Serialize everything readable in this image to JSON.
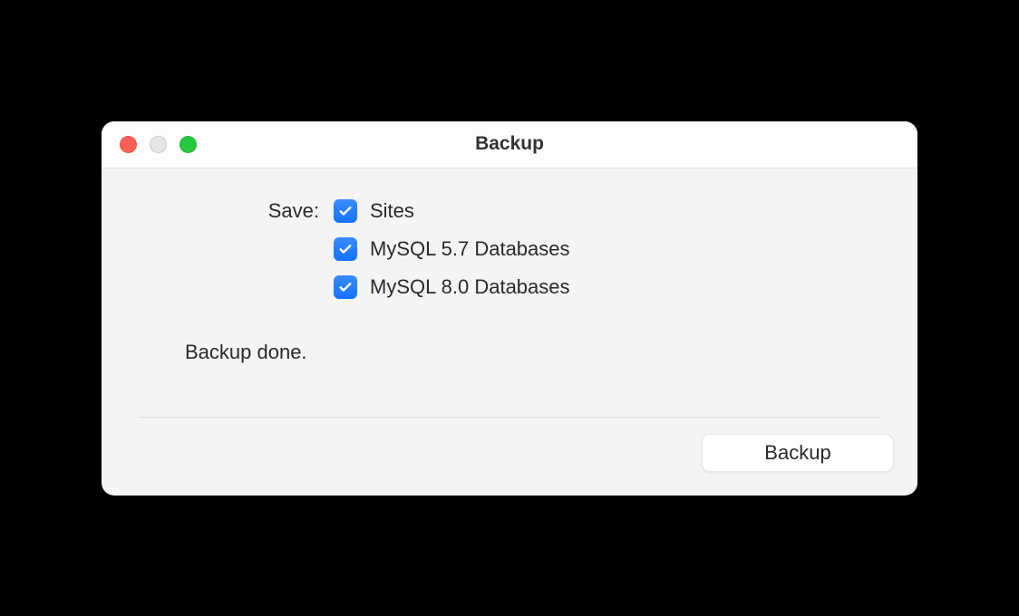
{
  "window": {
    "title": "Backup"
  },
  "form": {
    "save_label": "Save:",
    "options": [
      {
        "label": "Sites",
        "checked": true
      },
      {
        "label": "MySQL 5.7 Databases",
        "checked": true
      },
      {
        "label": "MySQL 8.0 Databases",
        "checked": true
      }
    ]
  },
  "status": {
    "message": "Backup done."
  },
  "footer": {
    "backup_label": "Backup"
  }
}
